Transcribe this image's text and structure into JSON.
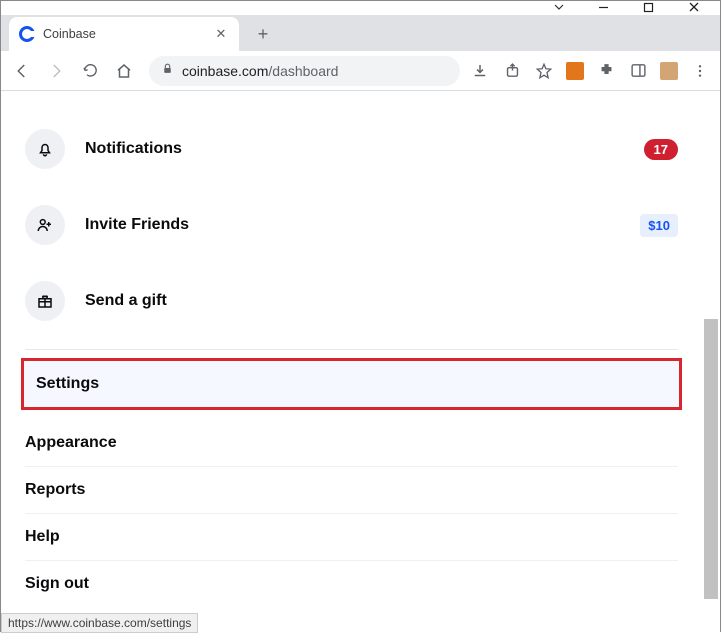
{
  "window": {
    "tab_title": "Coinbase",
    "url_host": "coinbase.com",
    "url_path": "/dashboard"
  },
  "menu": {
    "notifications": {
      "label": "Notifications",
      "count": "17"
    },
    "invite": {
      "label": "Invite Friends",
      "reward": "$10"
    },
    "gift": {
      "label": "Send a gift"
    }
  },
  "links": {
    "settings": "Settings",
    "appearance": "Appearance",
    "reports": "Reports",
    "help": "Help",
    "signout": "Sign out"
  },
  "status_url": "https://www.coinbase.com/settings"
}
